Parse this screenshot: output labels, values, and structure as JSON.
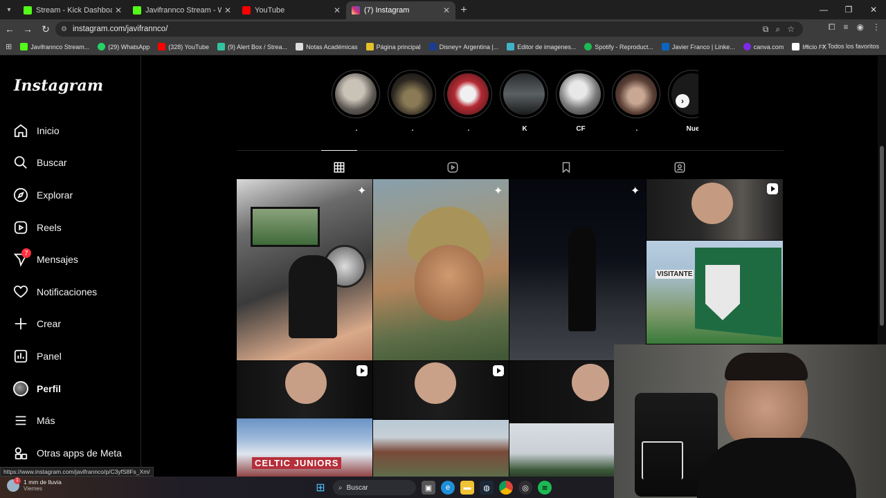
{
  "browser": {
    "tabs": [
      {
        "title": "Stream - Kick Dashboard",
        "color": "#53fc18",
        "active": false
      },
      {
        "title": "Javifrannco Stream - Watch Live",
        "color": "#53fc18",
        "active": false
      },
      {
        "title": "YouTube",
        "color": "#ff0000",
        "active": false
      },
      {
        "title": "(7) Instagram",
        "color": "#d62976",
        "active": true
      }
    ],
    "url": "instagram.com/javifrannco/",
    "bookmarks": [
      {
        "label": "Javifrannco Stream...",
        "color": "#53fc18"
      },
      {
        "label": "(29) WhatsApp",
        "color": "#25d366"
      },
      {
        "label": "(328) YouTube",
        "color": "#ff0000"
      },
      {
        "label": "(9) Alert Box / Strea...",
        "color": "#31c3a2"
      },
      {
        "label": "Notas Académicas",
        "color": "#dddddd"
      },
      {
        "label": "Página principal",
        "color": "#e6c229"
      },
      {
        "label": "Disney+ Argentina |...",
        "color": "#1a3d8f"
      },
      {
        "label": "Editor de imagenes...",
        "color": "#3fb4c9"
      },
      {
        "label": "Spotify - Reproduct...",
        "color": "#1db954"
      },
      {
        "label": "Javier Franco | Linke...",
        "color": "#0a66c2"
      },
      {
        "label": "canva.com",
        "color": "#7d2ae8"
      },
      {
        "label": "Inicio / X",
        "color": "#ffffff"
      }
    ],
    "all_bookmarks": "Todos los favoritos",
    "status_url": "https://www.instagram.com/javifrannco/p/C3yfS8Fs_Xm/"
  },
  "sidebar": {
    "logo": "Instagram",
    "items": [
      {
        "label": "Inicio",
        "icon": "home-icon"
      },
      {
        "label": "Buscar",
        "icon": "search-icon"
      },
      {
        "label": "Explorar",
        "icon": "compass-icon"
      },
      {
        "label": "Reels",
        "icon": "reels-icon"
      },
      {
        "label": "Mensajes",
        "icon": "messenger-icon",
        "badge": "7"
      },
      {
        "label": "Notificaciones",
        "icon": "heart-icon"
      },
      {
        "label": "Crear",
        "icon": "plus-icon"
      },
      {
        "label": "Panel",
        "icon": "bar-chart-icon"
      },
      {
        "label": "Perfil",
        "icon": "avatar-icon"
      },
      {
        "label": "Más",
        "icon": "menu-icon"
      },
      {
        "label": "Otras apps de Meta",
        "icon": "meta-apps-icon"
      }
    ]
  },
  "stories": [
    {
      "label": "."
    },
    {
      "label": "."
    },
    {
      "label": "."
    },
    {
      "label": "K"
    },
    {
      "label": "CF"
    },
    {
      "label": "."
    },
    {
      "label": "Nue"
    }
  ],
  "profile_tabs": [
    "posts-grid-icon",
    "reels-tab-icon",
    "saved-icon",
    "tagged-icon"
  ],
  "posts": [
    {
      "name": "post-studio",
      "pinned": true
    },
    {
      "name": "post-selfie",
      "pinned": true
    },
    {
      "name": "post-night-walk",
      "pinned": true
    },
    {
      "name": "post-stream-clip-1",
      "reel": true
    },
    {
      "name": "post-la-rinconada-sign",
      "text": "VISITANTE"
    },
    {
      "name": "post-stream-clip-2",
      "reel": true
    },
    {
      "name": "post-stream-clip-3",
      "reel": true
    },
    {
      "name": "post-stream-clip-4"
    },
    {
      "name": "post-celtic-juniors",
      "text": "CELTIC JUNIORS"
    },
    {
      "name": "post-houses"
    },
    {
      "name": "post-trees"
    }
  ],
  "taskbar": {
    "weather_line1": "1 mm de lluvia",
    "weather_line2": "Viernes",
    "weather_badge": "1",
    "search_label": "Buscar"
  }
}
